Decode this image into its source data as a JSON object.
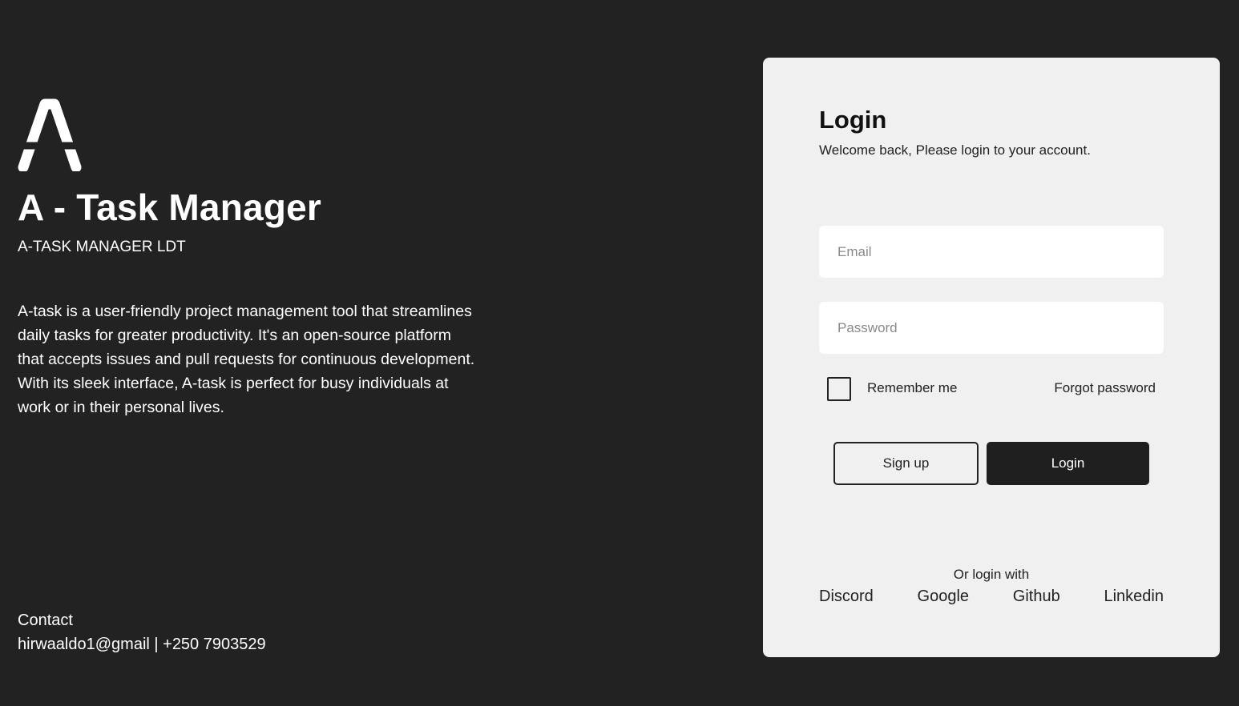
{
  "brand": {
    "logo_letter": "A",
    "title": "A - Task Manager",
    "company": "A-TASK MANAGER LDT",
    "description": "A-task is a user-friendly project management tool that streamlines daily tasks for greater productivity. It's an open-source platform that accepts issues and pull requests for continuous development. With its sleek interface, A-task is perfect for busy individuals at work or in their personal lives.",
    "contact_label": "Contact",
    "contact_info": "hirwaaldo1@gmail | +250 7903529"
  },
  "login": {
    "title": "Login",
    "subtitle": "Welcome back, Please login to your account.",
    "email_placeholder": "Email",
    "password_placeholder": "Password",
    "remember_label": "Remember me",
    "remember_checked": false,
    "forgot_label": "Forgot password",
    "signup_button": "Sign up",
    "login_button": "Login",
    "or_login_with": "Or login with",
    "social": [
      "Discord",
      "Google",
      "Github",
      "Linkedin"
    ]
  },
  "colors": {
    "background": "#222222",
    "card": "#f0f0f0",
    "primary_button": "#1f1f1f",
    "text_light": "#ffffff",
    "text_dark": "#111111"
  }
}
